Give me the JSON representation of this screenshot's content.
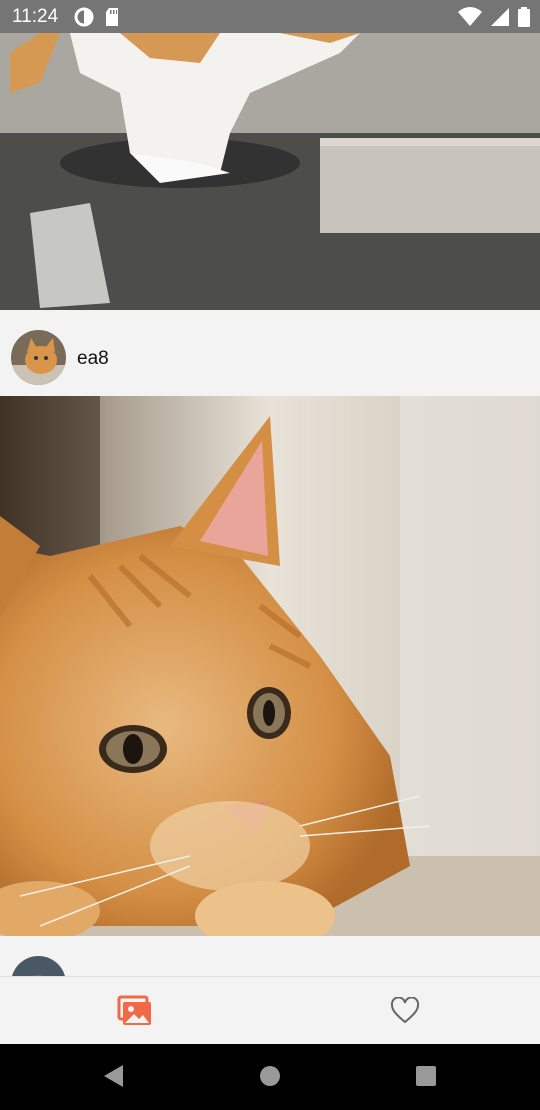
{
  "status_bar": {
    "time": "11:24",
    "left_icons": [
      "data-saver-icon",
      "sd-card-icon"
    ],
    "right_icons": [
      "wifi-icon",
      "cell-signal-icon",
      "battery-icon"
    ]
  },
  "feed": {
    "posts": [
      {
        "username": "ea8",
        "avatar": "cat-avatar"
      },
      {
        "username": "",
        "avatar": "cat-avatar-2"
      }
    ]
  },
  "bottom_nav": {
    "items": [
      {
        "icon": "photo-gallery-icon",
        "active": true
      },
      {
        "icon": "heart-outline-icon",
        "active": false
      }
    ],
    "accent_color": "#f06a45"
  },
  "system_nav": [
    "back-icon",
    "home-icon",
    "recents-icon"
  ]
}
